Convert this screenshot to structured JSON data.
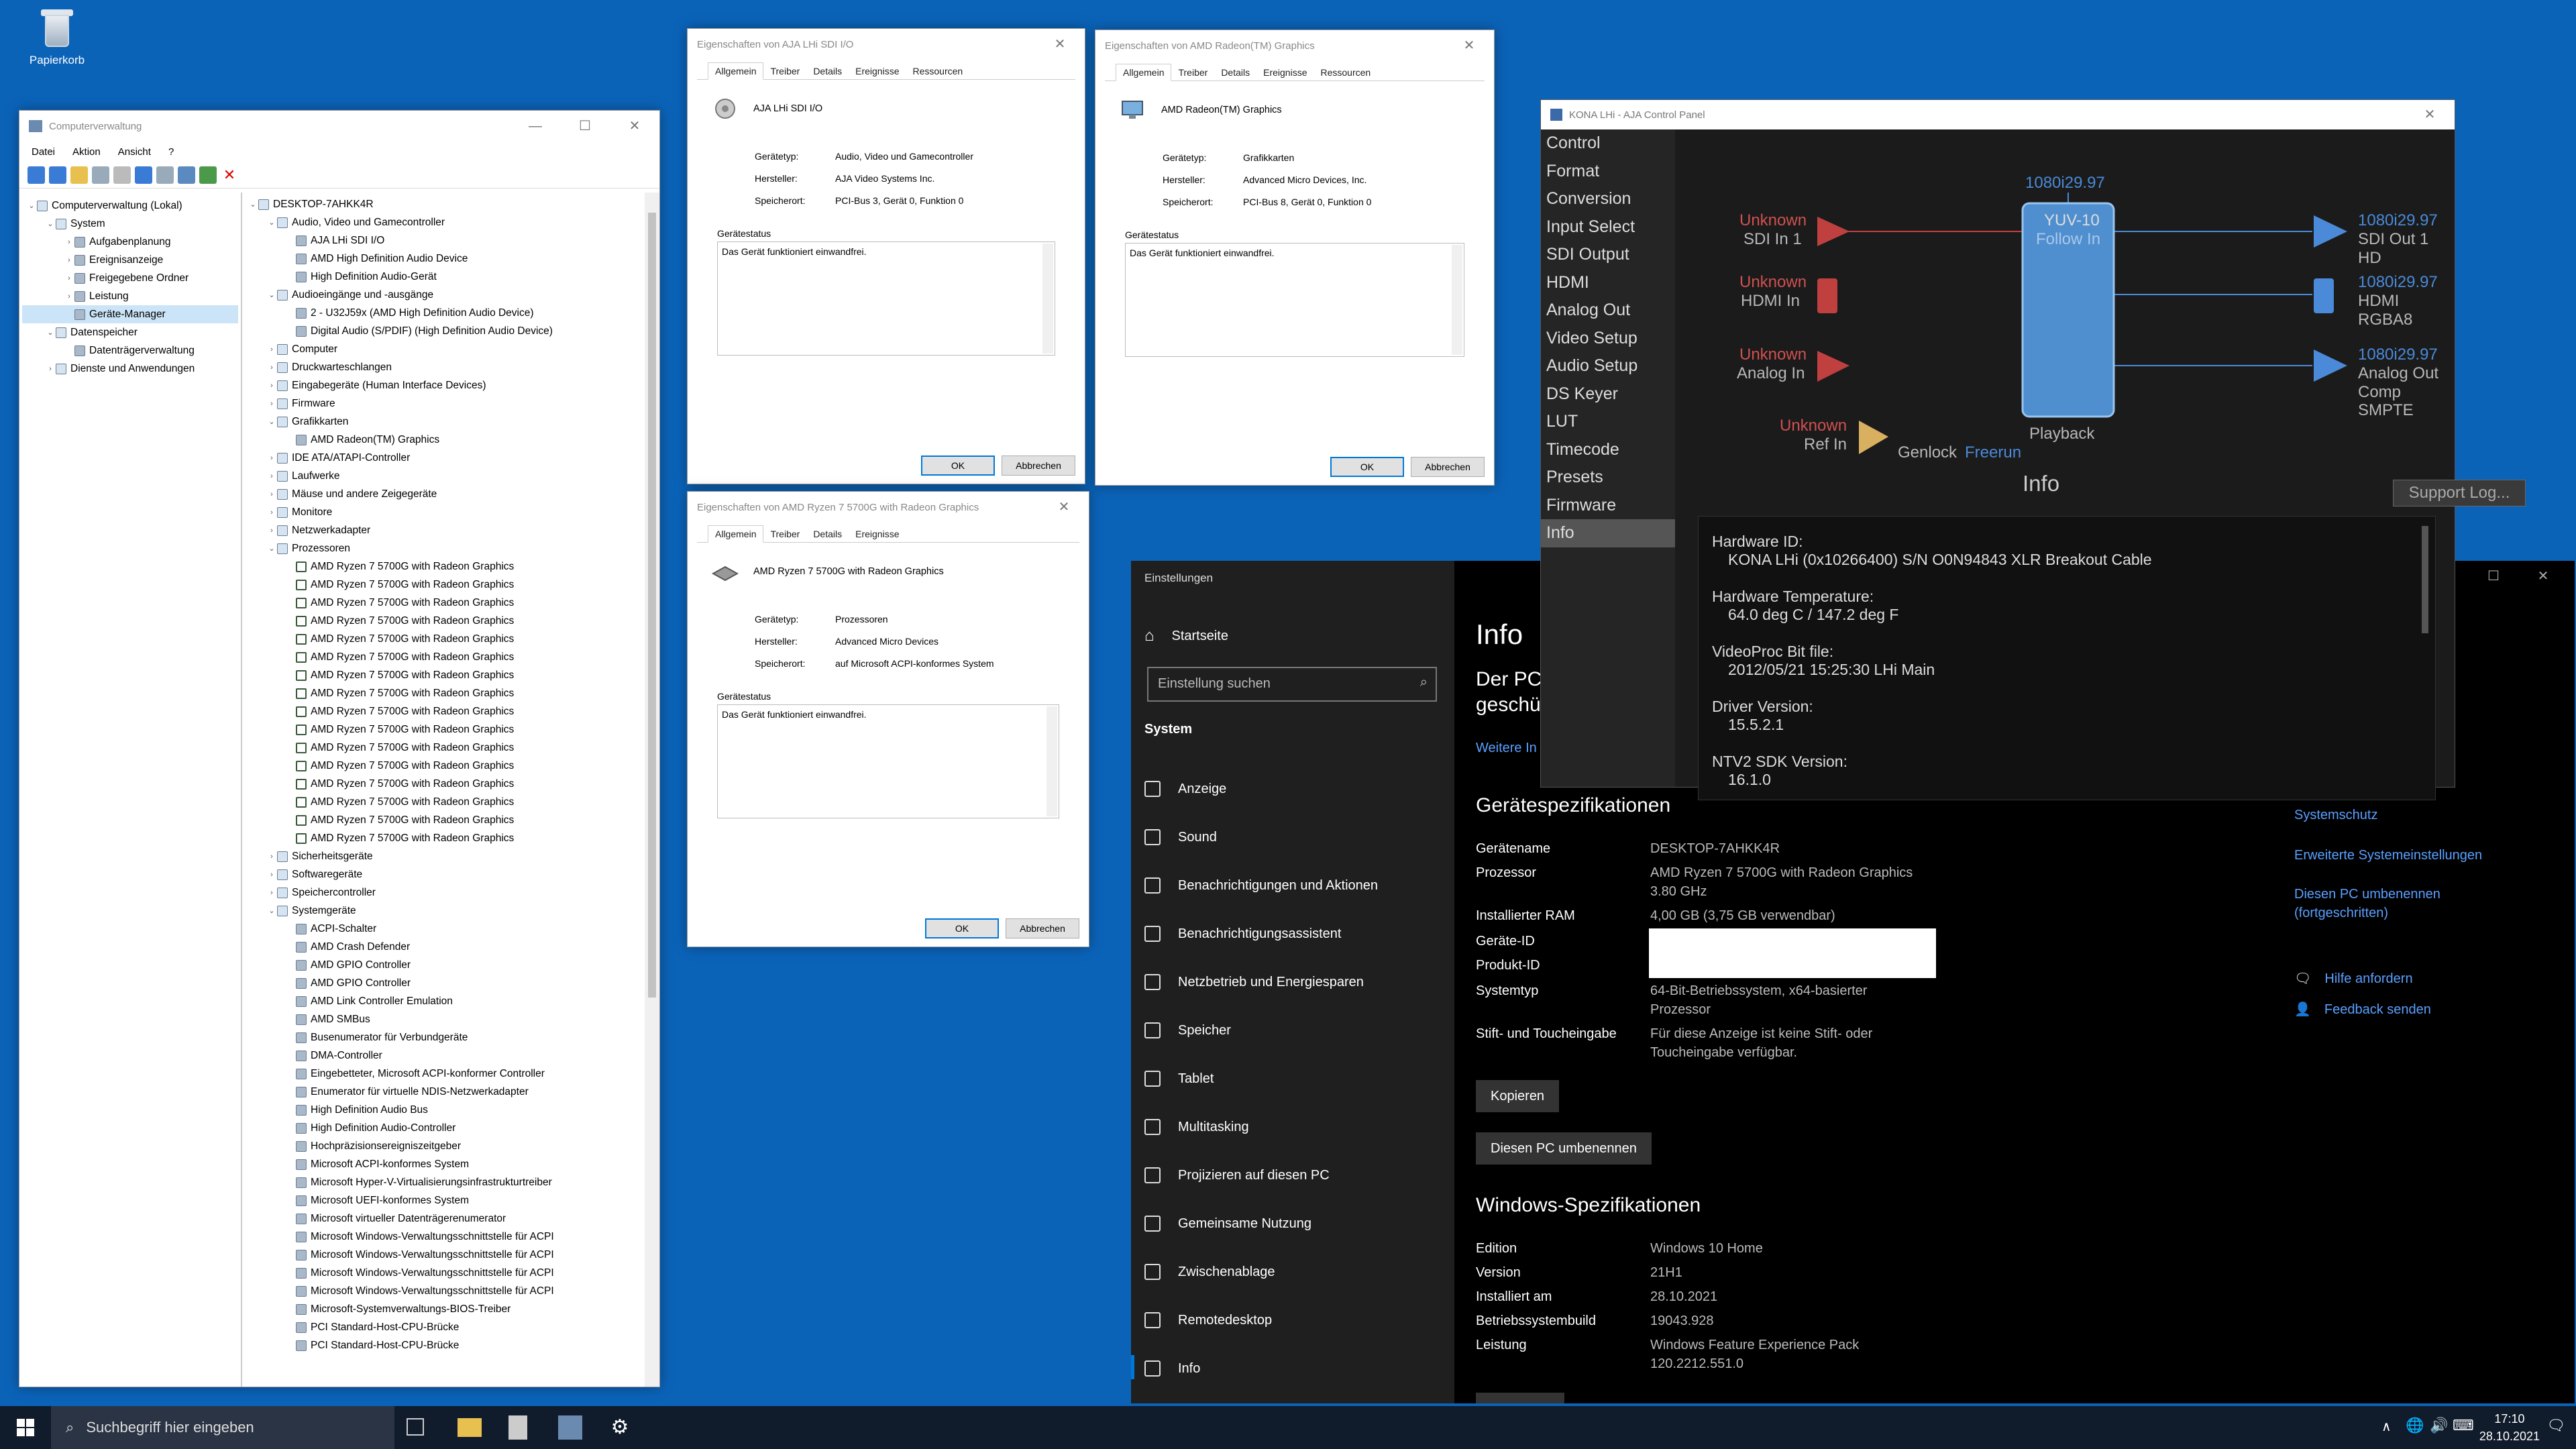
{
  "desktop": {
    "recycle_bin": "Papierkorb"
  },
  "compmgmt": {
    "title": "Computerverwaltung",
    "menu": [
      "Datei",
      "Aktion",
      "Ansicht",
      "?"
    ],
    "left": [
      {
        "label": "Computerverwaltung (Lokal)",
        "level": 0,
        "arrow": "v"
      },
      {
        "label": "System",
        "level": 1,
        "arrow": "v"
      },
      {
        "label": "Aufgabenplanung",
        "level": 2,
        "arrow": ">"
      },
      {
        "label": "Ereignisanzeige",
        "level": 2,
        "arrow": ">"
      },
      {
        "label": "Freigegebene Ordner",
        "level": 2,
        "arrow": ">"
      },
      {
        "label": "Leistung",
        "level": 2,
        "arrow": ">"
      },
      {
        "label": "Geräte-Manager",
        "level": 2,
        "arrow": "",
        "selected": true
      },
      {
        "label": "Datenspeicher",
        "level": 1,
        "arrow": "v"
      },
      {
        "label": "Datenträgerverwaltung",
        "level": 2,
        "arrow": ""
      },
      {
        "label": "Dienste und Anwendungen",
        "level": 1,
        "arrow": ">"
      }
    ],
    "right": [
      {
        "label": "DESKTOP-7AHKK4R",
        "level": 0,
        "arrow": "v"
      },
      {
        "label": "Audio, Video und Gamecontroller",
        "level": 1,
        "arrow": "v"
      },
      {
        "label": "AJA LHi SDI I/O",
        "level": 2,
        "arrow": ""
      },
      {
        "label": "AMD High Definition Audio Device",
        "level": 2,
        "arrow": ""
      },
      {
        "label": "High Definition Audio-Gerät",
        "level": 2,
        "arrow": ""
      },
      {
        "label": "Audioeingänge und -ausgänge",
        "level": 1,
        "arrow": "v"
      },
      {
        "label": "2 - U32J59x (AMD High Definition Audio Device)",
        "level": 2,
        "arrow": ""
      },
      {
        "label": "Digital Audio (S/PDIF) (High Definition Audio Device)",
        "level": 2,
        "arrow": ""
      },
      {
        "label": "Computer",
        "level": 1,
        "arrow": ">"
      },
      {
        "label": "Druckwarteschlangen",
        "level": 1,
        "arrow": ">"
      },
      {
        "label": "Eingabegeräte (Human Interface Devices)",
        "level": 1,
        "arrow": ">"
      },
      {
        "label": "Firmware",
        "level": 1,
        "arrow": ">"
      },
      {
        "label": "Grafikkarten",
        "level": 1,
        "arrow": "v"
      },
      {
        "label": "AMD Radeon(TM) Graphics",
        "level": 2,
        "arrow": ""
      },
      {
        "label": "IDE ATA/ATAPI-Controller",
        "level": 1,
        "arrow": ">"
      },
      {
        "label": "Laufwerke",
        "level": 1,
        "arrow": ">"
      },
      {
        "label": "Mäuse und andere Zeigegeräte",
        "level": 1,
        "arrow": ">"
      },
      {
        "label": "Monitore",
        "level": 1,
        "arrow": ">"
      },
      {
        "label": "Netzwerkadapter",
        "level": 1,
        "arrow": ">"
      },
      {
        "label": "Prozessoren",
        "level": 1,
        "arrow": "v"
      },
      {
        "label": "AMD Ryzen 7 5700G with Radeon Graphics",
        "level": 2,
        "arrow": "",
        "chip": true
      },
      {
        "label": "AMD Ryzen 7 5700G with Radeon Graphics",
        "level": 2,
        "arrow": "",
        "chip": true
      },
      {
        "label": "AMD Ryzen 7 5700G with Radeon Graphics",
        "level": 2,
        "arrow": "",
        "chip": true
      },
      {
        "label": "AMD Ryzen 7 5700G with Radeon Graphics",
        "level": 2,
        "arrow": "",
        "chip": true
      },
      {
        "label": "AMD Ryzen 7 5700G with Radeon Graphics",
        "level": 2,
        "arrow": "",
        "chip": true
      },
      {
        "label": "AMD Ryzen 7 5700G with Radeon Graphics",
        "level": 2,
        "arrow": "",
        "chip": true
      },
      {
        "label": "AMD Ryzen 7 5700G with Radeon Graphics",
        "level": 2,
        "arrow": "",
        "chip": true
      },
      {
        "label": "AMD Ryzen 7 5700G with Radeon Graphics",
        "level": 2,
        "arrow": "",
        "chip": true
      },
      {
        "label": "AMD Ryzen 7 5700G with Radeon Graphics",
        "level": 2,
        "arrow": "",
        "chip": true
      },
      {
        "label": "AMD Ryzen 7 5700G with Radeon Graphics",
        "level": 2,
        "arrow": "",
        "chip": true
      },
      {
        "label": "AMD Ryzen 7 5700G with Radeon Graphics",
        "level": 2,
        "arrow": "",
        "chip": true
      },
      {
        "label": "AMD Ryzen 7 5700G with Radeon Graphics",
        "level": 2,
        "arrow": "",
        "chip": true
      },
      {
        "label": "AMD Ryzen 7 5700G with Radeon Graphics",
        "level": 2,
        "arrow": "",
        "chip": true
      },
      {
        "label": "AMD Ryzen 7 5700G with Radeon Graphics",
        "level": 2,
        "arrow": "",
        "chip": true
      },
      {
        "label": "AMD Ryzen 7 5700G with Radeon Graphics",
        "level": 2,
        "arrow": "",
        "chip": true
      },
      {
        "label": "AMD Ryzen 7 5700G with Radeon Graphics",
        "level": 2,
        "arrow": "",
        "chip": true
      },
      {
        "label": "Sicherheitsgeräte",
        "level": 1,
        "arrow": ">"
      },
      {
        "label": "Softwaregeräte",
        "level": 1,
        "arrow": ">"
      },
      {
        "label": "Speichercontroller",
        "level": 1,
        "arrow": ">"
      },
      {
        "label": "Systemgeräte",
        "level": 1,
        "arrow": "v"
      },
      {
        "label": "ACPI-Schalter",
        "level": 2,
        "arrow": ""
      },
      {
        "label": "AMD Crash Defender",
        "level": 2,
        "arrow": ""
      },
      {
        "label": "AMD GPIO Controller",
        "level": 2,
        "arrow": ""
      },
      {
        "label": "AMD GPIO Controller",
        "level": 2,
        "arrow": ""
      },
      {
        "label": "AMD Link Controller Emulation",
        "level": 2,
        "arrow": ""
      },
      {
        "label": "AMD SMBus",
        "level": 2,
        "arrow": ""
      },
      {
        "label": "Busenumerator für Verbundgeräte",
        "level": 2,
        "arrow": ""
      },
      {
        "label": "DMA-Controller",
        "level": 2,
        "arrow": ""
      },
      {
        "label": "Eingebetteter, Microsoft ACPI-konformer Controller",
        "level": 2,
        "arrow": ""
      },
      {
        "label": "Enumerator für virtuelle NDIS-Netzwerkadapter",
        "level": 2,
        "arrow": ""
      },
      {
        "label": "High Definition Audio Bus",
        "level": 2,
        "arrow": ""
      },
      {
        "label": "High Definition Audio-Controller",
        "level": 2,
        "arrow": ""
      },
      {
        "label": "Hochpräzisionsereigniszeitgeber",
        "level": 2,
        "arrow": ""
      },
      {
        "label": "Microsoft ACPI-konformes System",
        "level": 2,
        "arrow": ""
      },
      {
        "label": "Microsoft Hyper-V-Virtualisierungsinfrastrukturtreiber",
        "level": 2,
        "arrow": ""
      },
      {
        "label": "Microsoft UEFI-konformes System",
        "level": 2,
        "arrow": ""
      },
      {
        "label": "Microsoft virtueller Datenträgerenumerator",
        "level": 2,
        "arrow": ""
      },
      {
        "label": "Microsoft Windows-Verwaltungsschnittstelle für ACPI",
        "level": 2,
        "arrow": ""
      },
      {
        "label": "Microsoft Windows-Verwaltungsschnittstelle für ACPI",
        "level": 2,
        "arrow": ""
      },
      {
        "label": "Microsoft Windows-Verwaltungsschnittstelle für ACPI",
        "level": 2,
        "arrow": ""
      },
      {
        "label": "Microsoft Windows-Verwaltungsschnittstelle für ACPI",
        "level": 2,
        "arrow": ""
      },
      {
        "label": "Microsoft-Systemverwaltungs-BIOS-Treiber",
        "level": 2,
        "arrow": ""
      },
      {
        "label": "PCI Standard-Host-CPU-Brücke",
        "level": 2,
        "arrow": ""
      },
      {
        "label": "PCI Standard-Host-CPU-Brücke",
        "level": 2,
        "arrow": ""
      }
    ]
  },
  "dlg_aja": {
    "title": "Eigenschaften von AJA LHi SDI I/O",
    "tabs": [
      "Allgemein",
      "Treiber",
      "Details",
      "Ereignisse",
      "Ressourcen"
    ],
    "name": "AJA LHi SDI I/O",
    "k1": "Gerätetyp:",
    "v1": "Audio, Video und Gamecontroller",
    "k2": "Hersteller:",
    "v2": "AJA Video Systems Inc.",
    "k3": "Speicherort:",
    "v3": "PCI-Bus 3, Gerät 0, Funktion 0",
    "status_label": "Gerätestatus",
    "status": "Das Gerät funktioniert einwandfrei.",
    "ok": "OK",
    "cancel": "Abbrechen"
  },
  "dlg_amd": {
    "title": "Eigenschaften von AMD Radeon(TM) Graphics",
    "tabs": [
      "Allgemein",
      "Treiber",
      "Details",
      "Ereignisse",
      "Ressourcen"
    ],
    "name": "AMD Radeon(TM) Graphics",
    "k1": "Gerätetyp:",
    "v1": "Grafikkarten",
    "k2": "Hersteller:",
    "v2": "Advanced Micro Devices, Inc.",
    "k3": "Speicherort:",
    "v3": "PCI-Bus 8, Gerät 0, Funktion 0",
    "status_label": "Gerätestatus",
    "status": "Das Gerät funktioniert einwandfrei.",
    "ok": "OK",
    "cancel": "Abbrechen"
  },
  "dlg_cpu": {
    "title": "Eigenschaften von AMD Ryzen 7 5700G with Radeon Graphics",
    "tabs": [
      "Allgemein",
      "Treiber",
      "Details",
      "Ereignisse"
    ],
    "name": "AMD Ryzen 7 5700G with Radeon Graphics",
    "k1": "Gerätetyp:",
    "v1": "Prozessoren",
    "k2": "Hersteller:",
    "v2": "Advanced Micro Devices",
    "k3": "Speicherort:",
    "v3": "auf Microsoft ACPI-konformes System",
    "status_label": "Gerätestatus",
    "status": "Das Gerät funktioniert einwandfrei.",
    "ok": "OK",
    "cancel": "Abbrechen"
  },
  "aja": {
    "title": "KONA LHi - AJA Control Panel",
    "nav": [
      "Control",
      "Format",
      "Conversion",
      "Input Select",
      "SDI Output",
      "HDMI",
      "Analog Out",
      "Video Setup",
      "Audio Setup",
      "DS Keyer",
      "LUT",
      "Timecode",
      "Presets",
      "Firmware",
      "Info"
    ],
    "top_format": "1080i29.97",
    "yuv": "YUV-10",
    "follow": "Follow In",
    "playback": "Playback",
    "in_unknown": "Unknown",
    "in1": "SDI In 1",
    "in2": "HDMI In",
    "in3": "Analog In",
    "ref": "Ref In",
    "genlock": "Genlock",
    "freerun": "Freerun",
    "out_fmt": "1080i29.97",
    "out1a": "SDI Out 1",
    "out1b": "HD",
    "out2a": "HDMI",
    "out2b": "RGBA8",
    "out3a": "Analog Out",
    "out3b": "Comp SMPTE",
    "info_title": "Info",
    "support": "Support Log...",
    "hw_id_l": "Hardware ID:",
    "hw_id_v": "KONA LHi  (0x10266400)  S/N O0N94843  XLR Breakout Cable",
    "temp_l": "Hardware Temperature:",
    "temp_v": "64.0 deg C / 147.2 deg F",
    "bit_l": "VideoProc Bit file:",
    "bit_v": "2012/05/21  15:25:30  LHi  Main",
    "drv_l": "Driver Version:",
    "drv_v": "15.5.2.1",
    "sdk_l": "NTV2 SDK Version:",
    "sdk_v": "16.1.0"
  },
  "settings": {
    "title": "Einstellungen",
    "home": "Startseite",
    "search_ph": "Einstellung suchen",
    "section": "System",
    "nav": [
      "Anzeige",
      "Sound",
      "Benachrichtigungen und Aktionen",
      "Benachrichtigungsassistent",
      "Netzbetrieb und Energiesparen",
      "Speicher",
      "Tablet",
      "Multitasking",
      "Projizieren auf diesen PC",
      "Gemeinsame Nutzung",
      "Zwischenablage",
      "Remotedesktop",
      "Info"
    ],
    "h": "Info",
    "monitor1": "Der PC",
    "monitor2": "geschü",
    "more": "Weitere In",
    "dev_h": "Gerätespezifikationen",
    "k_name": "Gerätename",
    "v_name": "DESKTOP-7AHKK4R",
    "k_cpu": "Prozessor",
    "v_cpu1": "AMD Ryzen 7 5700G with Radeon Graphics",
    "v_cpu2": "3.80 GHz",
    "k_ram": "Installierter RAM",
    "v_ram": "4,00 GB (3,75 GB verwendbar)",
    "k_devid": "Geräte-ID",
    "k_prodid": "Produkt-ID",
    "k_type": "Systemtyp",
    "v_type1": "64-Bit-Betriebssystem, x64-basierter",
    "v_type2": "Prozessor",
    "k_pen": "Stift- und Toucheingabe",
    "v_pen1": "Für diese Anzeige ist keine Stift- oder",
    "v_pen2": "Toucheingabe verfügbar.",
    "copy": "Kopieren",
    "rename": "Diesen PC umbenennen",
    "win_h": "Windows-Spezifikationen",
    "k_ed": "Edition",
    "v_ed": "Windows 10 Home",
    "k_ver": "Version",
    "v_ver": "21H1",
    "k_inst": "Installiert am",
    "v_inst": "28.10.2021",
    "k_build": "Betriebssystembuild",
    "v_build": "19043.928",
    "k_perf": "Leistung",
    "v_perf1": "Windows Feature Experience Pack",
    "v_perf2": "120.2212.551.0",
    "r1": "Systemschutz",
    "r2": "Erweiterte Systemeinstellungen",
    "r3a": "Diesen PC umbenennen",
    "r3b": "(fortgeschritten)",
    "help": "Hilfe anfordern",
    "feedback": "Feedback senden"
  },
  "taskbar": {
    "search": "Suchbegriff hier eingeben",
    "time": "17:10",
    "date": "28.10.2021"
  }
}
